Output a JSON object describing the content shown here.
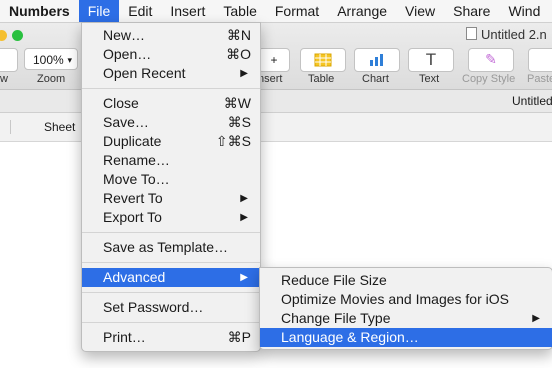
{
  "menubar": {
    "app": "Numbers",
    "items": [
      "File",
      "Edit",
      "Insert",
      "Table",
      "Format",
      "Arrange",
      "View",
      "Share",
      "Wind"
    ]
  },
  "window": {
    "title": "Untitled 2.n"
  },
  "toolbar": {
    "zoom_value": "100%",
    "labels": {
      "view": "w",
      "zoom": "Zoom",
      "insert": "nsert",
      "table": "Table",
      "chart": "Chart",
      "text": "Text",
      "copy_style": "Copy Style",
      "paste": "Paste"
    }
  },
  "subbar": {
    "title": "Untitled"
  },
  "sheetbar": {
    "sheet": "Sheet"
  },
  "file_menu": {
    "new": "New…",
    "new_sc": "⌘N",
    "open": "Open…",
    "open_sc": "⌘O",
    "open_recent": "Open Recent",
    "close": "Close",
    "close_sc": "⌘W",
    "save": "Save…",
    "save_sc": "⌘S",
    "duplicate": "Duplicate",
    "duplicate_sc": "⇧⌘S",
    "rename": "Rename…",
    "move_to": "Move To…",
    "revert_to": "Revert To",
    "export_to": "Export To",
    "save_template": "Save as Template…",
    "advanced": "Advanced",
    "set_password": "Set Password…",
    "print": "Print…",
    "print_sc": "⌘P"
  },
  "advanced_menu": {
    "reduce": "Reduce File Size",
    "optimize": "Optimize Movies and Images for iOS",
    "change_type": "Change File Type",
    "language": "Language & Region…"
  },
  "colors": {
    "highlight": "#2d6ee6",
    "table_icon": "#f6c623",
    "chart_icon": "#2f7fd8",
    "traffic_yellow": "#f5bf2f",
    "traffic_green": "#29c03f"
  }
}
